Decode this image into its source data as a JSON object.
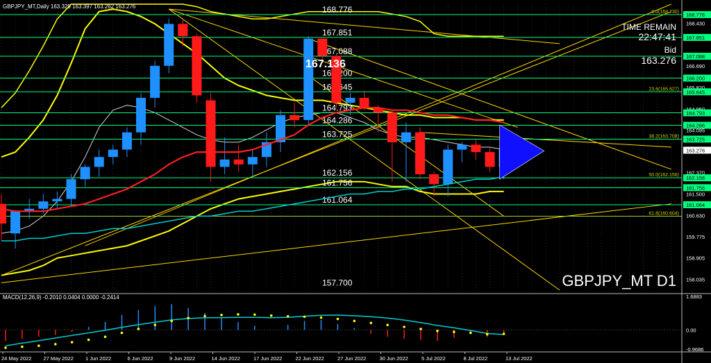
{
  "window": {
    "header": "GBPJPY_MT,Daily  163.329 163.397 163.262 163.276",
    "symbol_label": "GBPJPY_MT D1",
    "time_remain_label": "TIME REMAIN",
    "time_remain_value": "22:47:41",
    "bid_label": "Bid",
    "bid_value": "163.276",
    "highlight_price": "167.136"
  },
  "macd": {
    "header": "MACD(12,26,9) -0.2010 0.0404 0.0000 -0.2414",
    "axis_labels": [
      "1.6883",
      "0.00",
      "-0.9686"
    ],
    "hist": [
      -0.55,
      -0.45,
      -0.35,
      -0.25,
      -0.1,
      0.15,
      0.4,
      0.75,
      1.0,
      1.2,
      1.3,
      1.1,
      0.85,
      0.6,
      0.4,
      0.2,
      0.0,
      0.25,
      0.45,
      0.5,
      0.3,
      0.1,
      -0.2,
      -0.35,
      -0.45,
      -0.5,
      -0.55,
      -0.4,
      -0.2,
      -0.35,
      -0.2
    ],
    "signal": [
      -0.9,
      -0.85,
      -0.8,
      -0.72,
      -0.62,
      -0.5,
      -0.35,
      -0.15,
      0.05,
      0.25,
      0.45,
      0.6,
      0.7,
      0.75,
      0.78,
      0.77,
      0.72,
      0.68,
      0.66,
      0.62,
      0.55,
      0.45,
      0.35,
      0.25,
      0.15,
      0.05,
      -0.05,
      -0.1,
      -0.15,
      -0.22,
      -0.2
    ]
  },
  "colors": {
    "up": "#1e90ff",
    "down": "#ff1a1a",
    "level": "#00ff7f",
    "gold": "#ffd700",
    "yellow": "#ffff00",
    "cyan": "#00ced1",
    "red_ma": "#ff2020",
    "blue_triangle": "#1010ff"
  },
  "chart_data": {
    "type": "candlestick",
    "title": "GBPJPY_MT D1",
    "timeframe": "Daily",
    "ylim": [
      157.6,
      169.2
    ],
    "date_labels": [
      "24 May 2022",
      "27 May 2022",
      "1 Jun 2022",
      "6 Jun 2022",
      "9 Jun 2022",
      "14 Jun 2022",
      "17 Jun 2022",
      "22 Jun 2022",
      "27 Jun 2022",
      "30 Jun 2022",
      "5 Jul 2022",
      "8 Jul 2022",
      "13 Jul 2022"
    ],
    "candles": [
      {
        "o": 161.1,
        "h": 161.5,
        "l": 159.6,
        "c": 160.3
      },
      {
        "o": 159.9,
        "h": 160.8,
        "l": 159.3,
        "c": 160.8
      },
      {
        "o": 160.8,
        "h": 161.3,
        "l": 160.5,
        "c": 160.9
      },
      {
        "o": 160.9,
        "h": 161.5,
        "l": 160.7,
        "c": 161.2
      },
      {
        "o": 161.2,
        "h": 161.6,
        "l": 160.9,
        "c": 161.3
      },
      {
        "o": 161.3,
        "h": 162.3,
        "l": 161.0,
        "c": 162.1
      },
      {
        "o": 162.1,
        "h": 162.7,
        "l": 161.8,
        "c": 162.6
      },
      {
        "o": 162.6,
        "h": 163.3,
        "l": 162.2,
        "c": 163.0
      },
      {
        "o": 163.0,
        "h": 163.5,
        "l": 162.7,
        "c": 163.3
      },
      {
        "o": 163.3,
        "h": 164.2,
        "l": 163.0,
        "c": 164.0
      },
      {
        "o": 164.0,
        "h": 165.6,
        "l": 163.5,
        "c": 165.4
      },
      {
        "o": 165.4,
        "h": 166.9,
        "l": 165.0,
        "c": 166.7
      },
      {
        "o": 166.7,
        "h": 168.6,
        "l": 166.4,
        "c": 168.4
      },
      {
        "o": 168.4,
        "h": 168.6,
        "l": 167.5,
        "c": 167.9
      },
      {
        "o": 167.9,
        "h": 168.0,
        "l": 165.2,
        "c": 165.5
      },
      {
        "o": 165.3,
        "h": 165.6,
        "l": 162.0,
        "c": 162.6
      },
      {
        "o": 162.6,
        "h": 163.8,
        "l": 162.3,
        "c": 162.9
      },
      {
        "o": 162.9,
        "h": 163.5,
        "l": 162.4,
        "c": 162.7
      },
      {
        "o": 162.7,
        "h": 163.3,
        "l": 162.2,
        "c": 163.0
      },
      {
        "o": 163.0,
        "h": 164.0,
        "l": 162.6,
        "c": 163.6
      },
      {
        "o": 163.6,
        "h": 164.9,
        "l": 163.2,
        "c": 164.7
      },
      {
        "o": 164.7,
        "h": 165.2,
        "l": 164.2,
        "c": 164.5
      },
      {
        "o": 164.5,
        "h": 167.9,
        "l": 164.3,
        "c": 167.8
      },
      {
        "o": 167.8,
        "h": 167.8,
        "l": 166.9,
        "c": 167.1
      },
      {
        "o": 167.1,
        "h": 167.2,
        "l": 165.0,
        "c": 165.2
      },
      {
        "o": 165.2,
        "h": 165.6,
        "l": 164.7,
        "c": 165.4
      },
      {
        "o": 165.4,
        "h": 165.7,
        "l": 164.9,
        "c": 165.0
      },
      {
        "o": 165.0,
        "h": 165.1,
        "l": 164.0,
        "c": 164.8
      },
      {
        "o": 164.8,
        "h": 164.9,
        "l": 162.0,
        "c": 163.6
      },
      {
        "o": 163.6,
        "h": 164.4,
        "l": 162.0,
        "c": 164.0
      },
      {
        "o": 164.0,
        "h": 164.2,
        "l": 162.1,
        "c": 162.3
      },
      {
        "o": 162.3,
        "h": 162.4,
        "l": 161.4,
        "c": 161.9
      },
      {
        "o": 161.9,
        "h": 163.5,
        "l": 161.4,
        "c": 163.3
      },
      {
        "o": 163.3,
        "h": 163.6,
        "l": 162.8,
        "c": 163.5
      },
      {
        "o": 163.5,
        "h": 163.7,
        "l": 162.9,
        "c": 163.2
      },
      {
        "o": 163.2,
        "h": 163.4,
        "l": 162.4,
        "c": 162.6
      },
      {
        "o": 162.6,
        "h": 163.6,
        "l": 162.1,
        "c": 163.3
      }
    ],
    "levels": [
      {
        "price": 168.776,
        "label": "168.776",
        "axis": "168.776",
        "fib": "0.0(168.730)"
      },
      {
        "price": 167.851,
        "label": "167.851",
        "axis": "167.851"
      },
      {
        "price": 167.088,
        "label": "167.088",
        "axis": "167.088"
      },
      {
        "price": 166.2,
        "label": "166.200",
        "axis": "166.200"
      },
      {
        "price": 165.645,
        "label": "165.645",
        "axis": "165.645",
        "fib": "23.6(165.627)"
      },
      {
        "price": 164.793,
        "label": "164.793",
        "axis": "164.793"
      },
      {
        "price": 164.286,
        "label": "164.286",
        "axis": "164.286"
      },
      {
        "price": 163.725,
        "label": "163.725",
        "axis": "163.725",
        "fib": "38.2(163.708)"
      },
      {
        "price": 162.156,
        "label": "162.156",
        "axis": "162.156",
        "fib": "50.0(162.156)"
      },
      {
        "price": 161.756,
        "label": "161.756",
        "axis": "161.756"
      },
      {
        "price": 161.064,
        "label": "161.064",
        "axis": "161.064"
      },
      {
        "price": 157.7,
        "label": "157.700"
      }
    ],
    "fib_extra": [
      {
        "price": 160.6,
        "label": "61.8(160.604)"
      }
    ],
    "axis_ticks": [
      {
        "price": 168.43,
        "label": "168.430"
      },
      {
        "price": 166.69,
        "label": "166.690"
      },
      {
        "price": 165.82,
        "label": "165.820"
      },
      {
        "price": 164.95,
        "label": "164.950"
      },
      {
        "price": 164.095,
        "label": "164.095"
      },
      {
        "price": 163.276,
        "label": "163.276"
      },
      {
        "price": 162.37,
        "label": "162.370"
      },
      {
        "price": 161.5,
        "label": "161.500"
      },
      {
        "price": 160.63,
        "label": "160.630"
      },
      {
        "price": 159.775,
        "label": "159.775"
      },
      {
        "price": 158.905,
        "label": "158.905"
      },
      {
        "price": 158.035,
        "label": "158.035"
      }
    ],
    "ma_red": [
      160.9,
      160.8,
      160.8,
      160.8,
      160.9,
      161.0,
      161.1,
      161.3,
      161.5,
      161.7,
      162.0,
      162.3,
      162.7,
      163.0,
      163.2,
      163.2,
      163.2,
      163.2,
      163.3,
      163.5,
      163.7,
      163.9,
      164.3,
      164.6,
      164.8,
      164.9,
      165.0,
      165.0,
      164.9,
      164.9,
      164.8,
      164.7,
      164.7,
      164.6,
      164.5,
      164.5,
      164.4
    ],
    "ma_cyan": [
      159.6,
      159.6,
      159.7,
      159.7,
      159.8,
      159.9,
      159.9,
      160.0,
      160.1,
      160.1,
      160.2,
      160.3,
      160.4,
      160.5,
      160.6,
      160.6,
      160.7,
      160.8,
      160.8,
      160.9,
      161.0,
      161.1,
      161.2,
      161.3,
      161.4,
      161.5,
      161.5,
      161.6,
      161.6,
      161.7,
      161.7,
      161.8,
      161.9,
      162.0,
      162.1,
      162.1,
      162.2
    ]
  }
}
